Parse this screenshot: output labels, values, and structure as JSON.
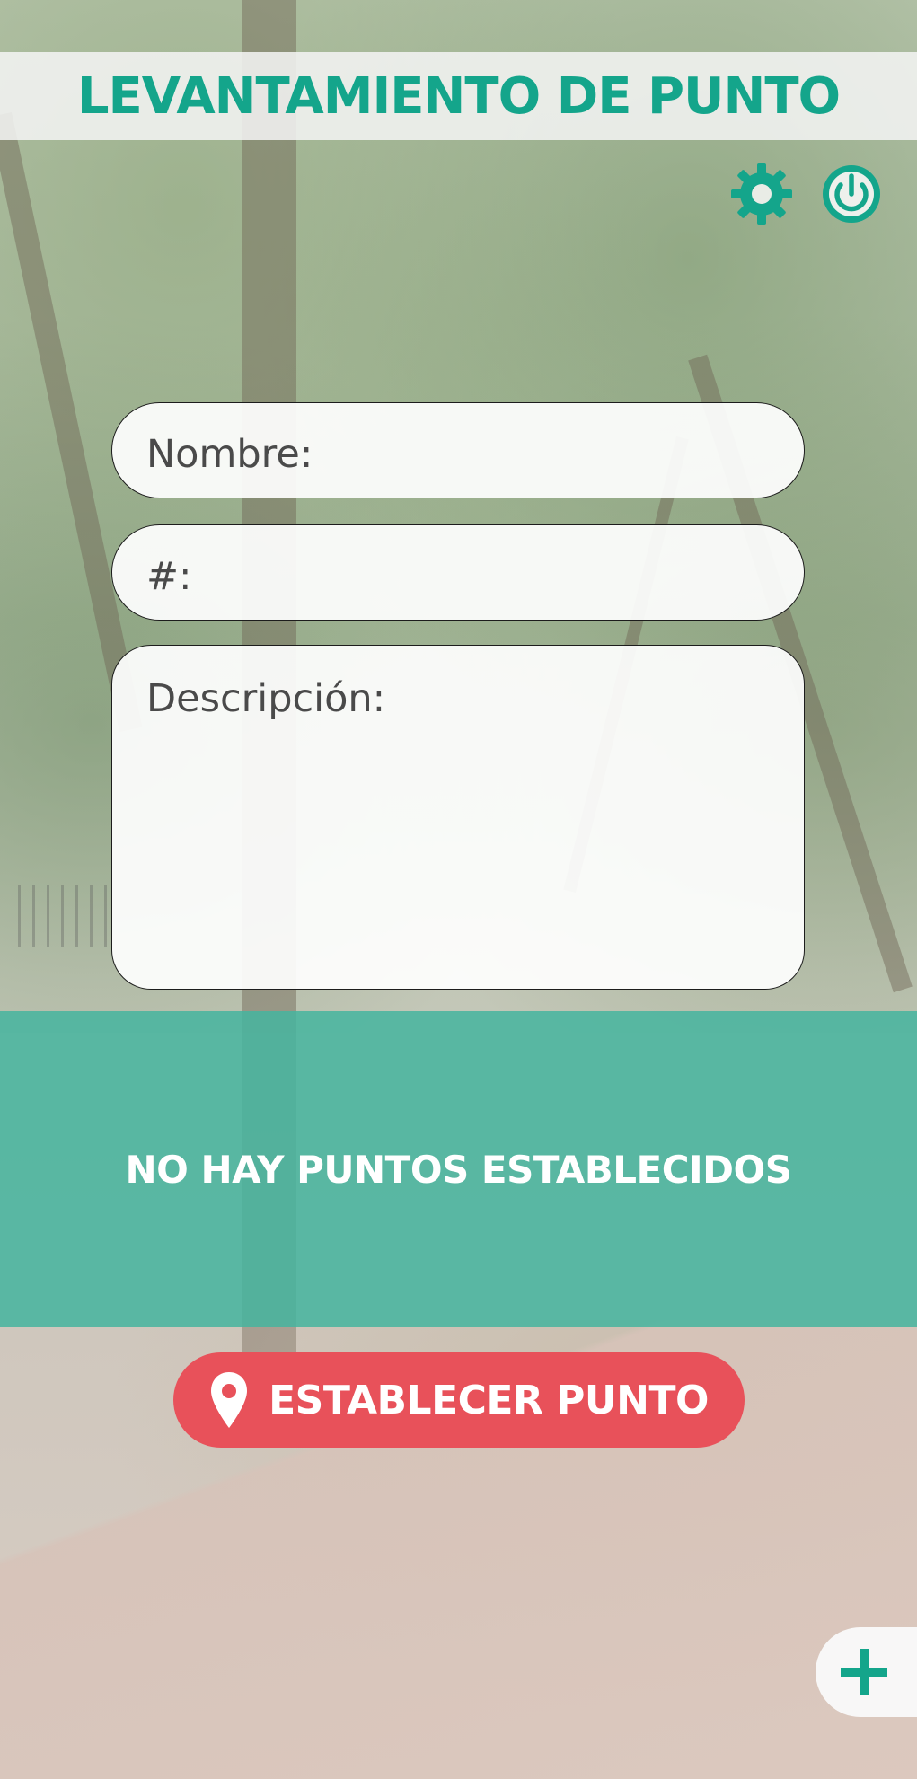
{
  "header": {
    "title": "LEVANTAMIENTO DE PUNTO"
  },
  "toolbar": {
    "settings_icon": "gear-icon",
    "power_icon": "power-icon"
  },
  "form": {
    "name_placeholder": "Nombre:",
    "number_placeholder": "#:",
    "description_placeholder": "Descripción:"
  },
  "status": {
    "message": "NO HAY PUNTOS ESTABLECIDOS"
  },
  "actions": {
    "set_point_label": "ESTABLECER PUNTO",
    "set_point_icon": "map-pin-icon",
    "add_icon": "plus-icon"
  },
  "colors": {
    "accent_teal": "#14a58b",
    "status_band": "#46b49e",
    "button_red": "#e8515a"
  }
}
